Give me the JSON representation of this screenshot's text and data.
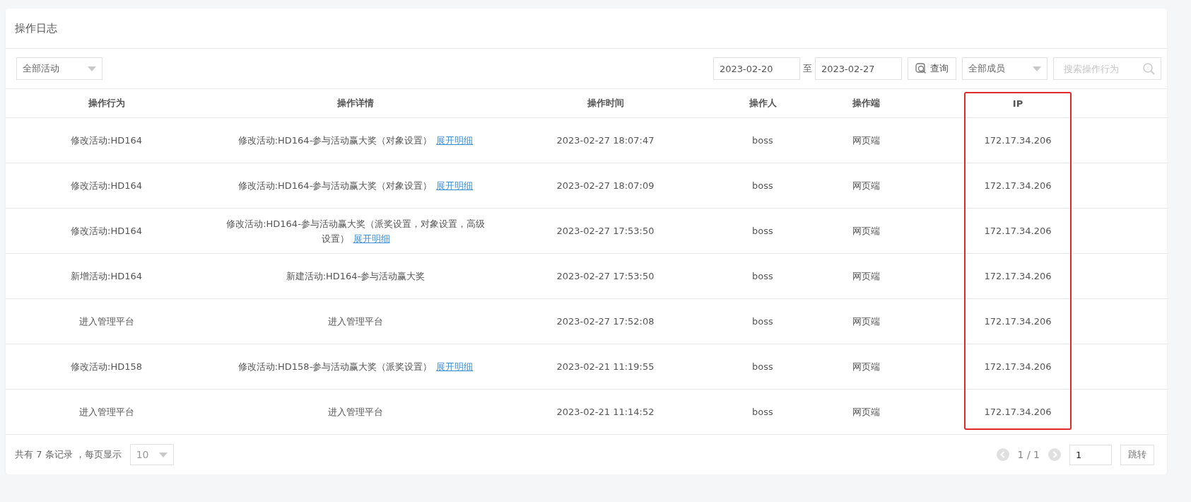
{
  "card": {
    "title": "操作日志"
  },
  "toolbar": {
    "activity_select": "全部活动",
    "date_from": "2023-02-20",
    "date_separator": "至",
    "date_to": "2023-02-27",
    "query_button": "查询",
    "member_select": "全部成员",
    "search": {
      "placeholder": "搜索操作行为"
    }
  },
  "table": {
    "columns": [
      {
        "label": "操作行为",
        "highlighted": false
      },
      {
        "label": "操作详情",
        "highlighted": false
      },
      {
        "label": "操作时间",
        "highlighted": false
      },
      {
        "label": "操作人",
        "highlighted": false
      },
      {
        "label": "操作端",
        "highlighted": false
      },
      {
        "label": "IP",
        "highlighted": true
      }
    ],
    "rows": [
      {
        "action": "修改活动:HD164",
        "detail": {
          "text": "修改活动:HD164-参与活动赢大奖（对象设置）",
          "link": "展开明细"
        },
        "time": "2023-02-27 18:07:47",
        "operator": "boss",
        "client": "网页端",
        "ip": "172.17.34.206"
      },
      {
        "action": "修改活动:HD164",
        "detail": {
          "text": "修改活动:HD164-参与活动赢大奖（对象设置）",
          "link": "展开明细"
        },
        "time": "2023-02-27 18:07:09",
        "operator": "boss",
        "client": "网页端",
        "ip": "172.17.34.206"
      },
      {
        "action": "修改活动:HD164",
        "detail": {
          "text": "修改活动:HD164-参与活动赢大奖（派奖设置，对象设置，高级设置）",
          "link": "展开明细"
        },
        "time": "2023-02-27 17:53:50",
        "operator": "boss",
        "client": "网页端",
        "ip": "172.17.34.206"
      },
      {
        "action": "新增活动:HD164",
        "detail": {
          "text": "新建活动:HD164-参与活动赢大奖"
        },
        "time": "2023-02-27 17:53:50",
        "operator": "boss",
        "client": "网页端",
        "ip": "172.17.34.206"
      },
      {
        "action": "进入管理平台",
        "detail": {
          "text": "进入管理平台"
        },
        "time": "2023-02-27 17:52:08",
        "operator": "boss",
        "client": "网页端",
        "ip": "172.17.34.206"
      },
      {
        "action": "修改活动:HD158",
        "detail": {
          "text": "修改活动:HD158-参与活动赢大奖（派奖设置）",
          "link": "展开明细"
        },
        "time": "2023-02-21 11:19:55",
        "operator": "boss",
        "client": "网页端",
        "ip": "172.17.34.206"
      },
      {
        "action": "进入管理平台",
        "detail": {
          "text": "进入管理平台"
        },
        "time": "2023-02-21 11:14:52",
        "operator": "boss",
        "client": "网页端",
        "ip": "172.17.34.206"
      }
    ]
  },
  "footer": {
    "summary": "共有 7 条记录 ，每页显示",
    "page_size": "10",
    "page_info": "1 / 1",
    "page_input": "1",
    "jump_button": "跳转"
  }
}
